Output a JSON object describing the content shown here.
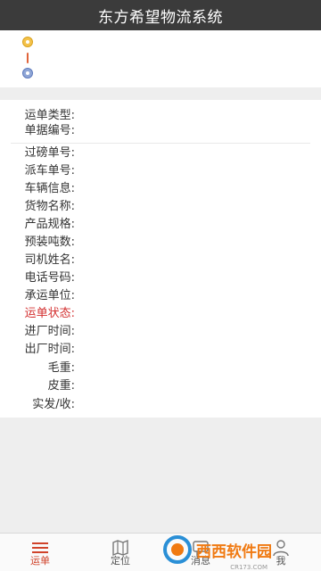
{
  "header": {
    "title": "东方希望物流系统"
  },
  "route": {
    "start_icon": "pin-start-icon",
    "end_icon": "pin-end-icon"
  },
  "details": {
    "group1": [
      {
        "label": "运单类型:",
        "value": ""
      },
      {
        "label": "单据编号:",
        "value": ""
      }
    ],
    "group2": [
      {
        "label": "过磅单号:",
        "value": ""
      },
      {
        "label": "派车单号:",
        "value": ""
      },
      {
        "label": "车辆信息:",
        "value": ""
      },
      {
        "label": "货物名称:",
        "value": ""
      },
      {
        "label": "产品规格:",
        "value": ""
      },
      {
        "label": "预装吨数:",
        "value": ""
      },
      {
        "label": "司机姓名:",
        "value": ""
      },
      {
        "label": "电话号码:",
        "value": ""
      },
      {
        "label": "承运单位:",
        "value": ""
      },
      {
        "label": "运单状态:",
        "value": ""
      },
      {
        "label": "进厂时间:",
        "value": ""
      },
      {
        "label": "出厂时间:",
        "value": ""
      },
      {
        "label": "毛重:",
        "value": ""
      },
      {
        "label": "皮重:",
        "value": ""
      },
      {
        "label": "实发/收:",
        "value": ""
      }
    ]
  },
  "tabbar": {
    "tabs": [
      {
        "label": "运单",
        "icon": "menu-icon"
      },
      {
        "label": "定位",
        "icon": "map-icon"
      },
      {
        "label": "消息",
        "icon": "message-icon"
      },
      {
        "label": "我",
        "icon": "user-icon"
      }
    ]
  },
  "watermark": {
    "text": "西西软件园",
    "sub": "CR173.COM"
  },
  "colors": {
    "header": "#3b3b3b",
    "accent": "#d0432a",
    "status_label": "#d32f2f"
  }
}
